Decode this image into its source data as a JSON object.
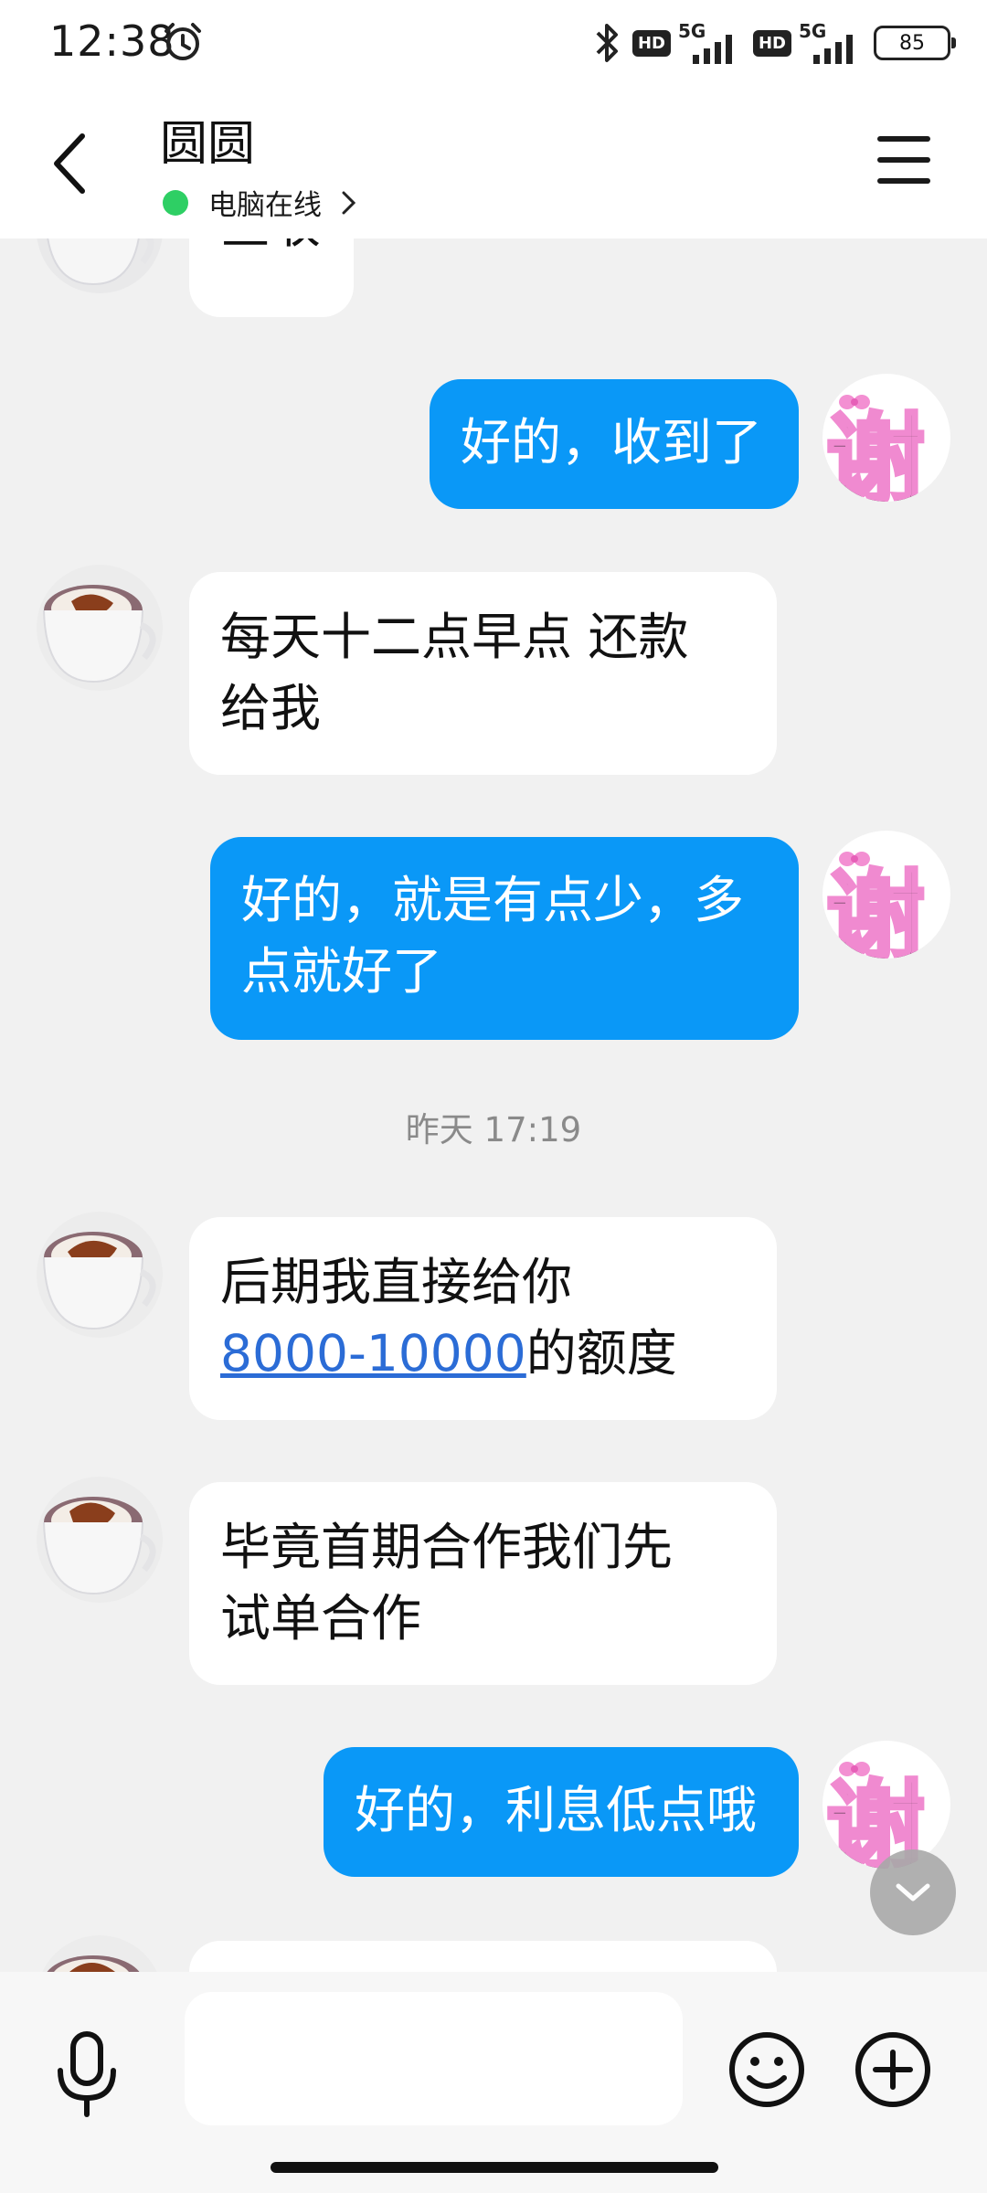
{
  "status_bar": {
    "time": "12:38",
    "alarm_icon": "alarm-clock-icon",
    "bluetooth_icon": "bluetooth-icon",
    "hd_badge": "HD",
    "network_type": "5G",
    "battery": "85"
  },
  "header": {
    "back_icon": "chevron-left-icon",
    "title": "圆圆",
    "online_status": "电脑在线",
    "menu_icon": "hamburger-menu-icon"
  },
  "messages": [
    {
      "side": "in",
      "text": "查收"
    },
    {
      "side": "out",
      "text": "好的，收到了"
    },
    {
      "side": "in",
      "line1": "每天十二点早点 还款",
      "line2": "给我"
    },
    {
      "side": "out",
      "line1": "好的，就是有点少，多",
      "line2": "点就好了"
    },
    {
      "timestamp": "昨天 17:19"
    },
    {
      "side": "in",
      "line1": "后期我直接给你",
      "link": "8000-10000",
      "line2_rest": "的额度"
    },
    {
      "side": "in",
      "line1": "毕竟首期合作我们先",
      "line2": "试单合作"
    },
    {
      "side": "out",
      "text": "好的，利息低点哦"
    }
  ],
  "sticker": {
    "char": "谢"
  },
  "input_bar": {
    "mic_icon": "microphone-icon",
    "placeholder": "",
    "emoji_icon": "smiley-face-icon",
    "plus_icon": "plus-circle-icon"
  },
  "colors": {
    "out_bubble": "#0a98f7",
    "in_bubble": "#ffffff",
    "background": "#f1f1f1",
    "online_dot": "#2ecf64",
    "link": "#2b6cd6"
  }
}
